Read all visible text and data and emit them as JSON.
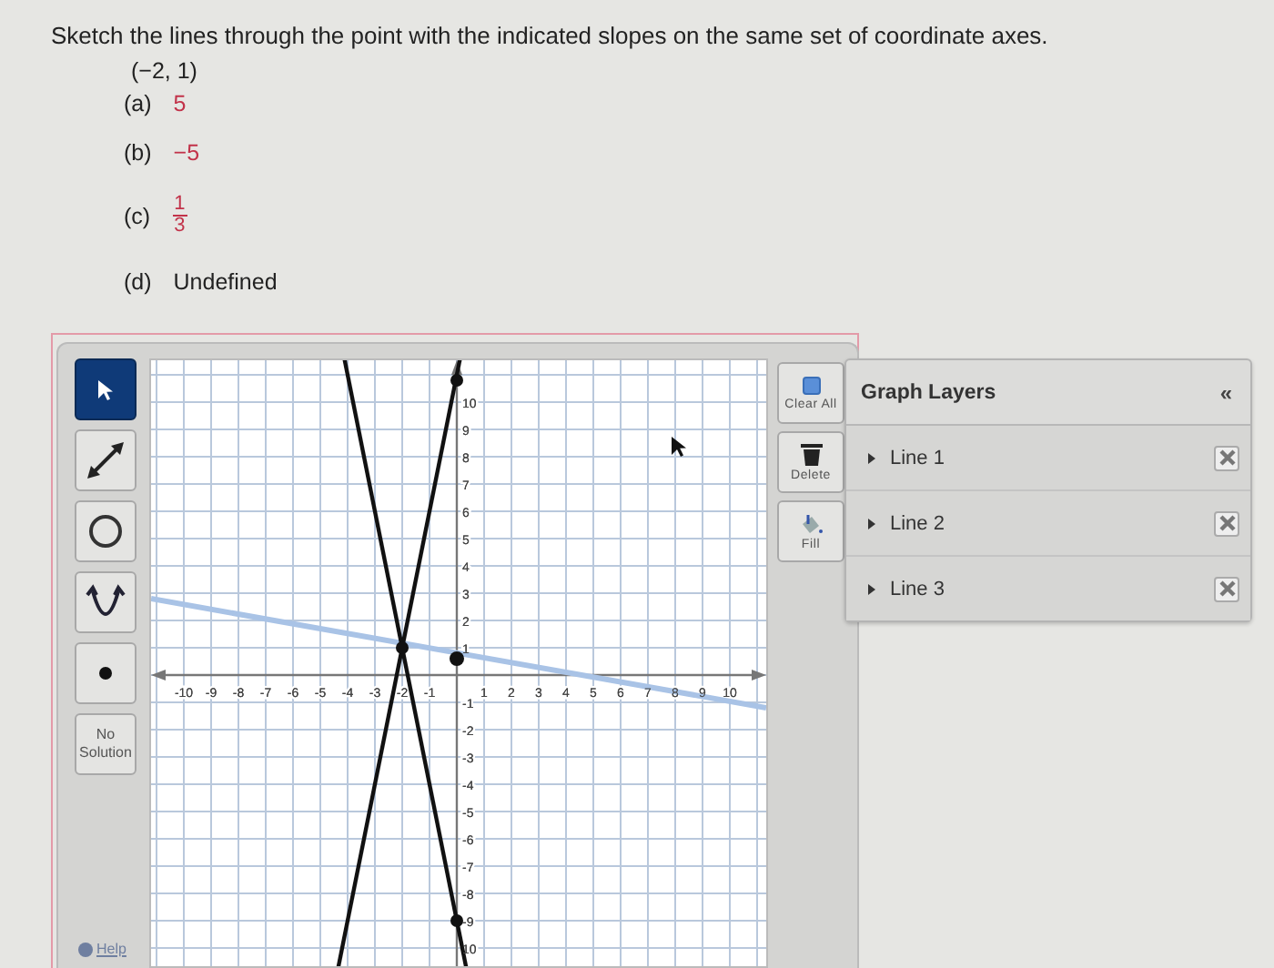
{
  "question": {
    "prompt": "Sketch the lines through the point with the indicated slopes on the same set of coordinate axes.",
    "point": "(−2, 1)",
    "parts": [
      {
        "label": "(a)",
        "kind": "number",
        "value": "5"
      },
      {
        "label": "(b)",
        "kind": "number",
        "value": "−5"
      },
      {
        "label": "(c)",
        "kind": "fraction",
        "numerator": "1",
        "denominator": "3"
      },
      {
        "label": "(d)",
        "kind": "text",
        "value": "Undefined"
      }
    ]
  },
  "tools": [
    {
      "kind": "pointer",
      "selected": true
    },
    {
      "kind": "line",
      "selected": false
    },
    {
      "kind": "circle",
      "selected": false
    },
    {
      "kind": "parabola",
      "selected": false
    },
    {
      "kind": "point",
      "selected": false
    },
    {
      "kind": "text",
      "label": "No Solution",
      "selected": false
    }
  ],
  "help": "Help",
  "graph": {
    "x_ticks": [
      "-10",
      "-9",
      "-8",
      "-7",
      "-6",
      "-5",
      "-4",
      "-3",
      "-2",
      "-1",
      "1",
      "2",
      "3",
      "4",
      "5",
      "6",
      "7",
      "8",
      "9",
      "10"
    ],
    "y_ticks": [
      "10",
      "9",
      "8",
      "7",
      "6",
      "5",
      "4",
      "3",
      "2",
      "1",
      "-1",
      "-2",
      "-3",
      "-4",
      "-5",
      "-6",
      "-7",
      "-8",
      "-9",
      "10"
    ]
  },
  "actions": [
    {
      "kind": "clear",
      "label": "Clear All"
    },
    {
      "kind": "delete",
      "label": "Delete"
    },
    {
      "kind": "fill",
      "label": "Fill"
    }
  ],
  "layers": {
    "title": "Graph Layers",
    "collapse": "«",
    "items": [
      {
        "label": "Line 1"
      },
      {
        "label": "Line 2"
      },
      {
        "label": "Line 3"
      }
    ]
  }
}
